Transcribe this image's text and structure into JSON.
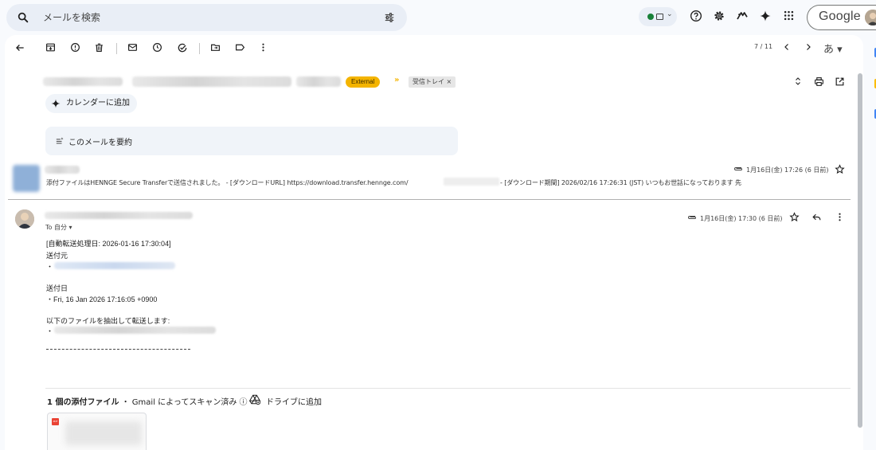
{
  "topbar": {
    "search_placeholder": "メールを検索",
    "google_label": "Google"
  },
  "toolbar": {
    "pager": "7 / 11",
    "ime_label": "あ ▾"
  },
  "thread": {
    "chip_external": "External",
    "chip_inbox": "受信トレイ ×",
    "calendar_button": "カレンダーに追加",
    "summary_button": "このメールを要約"
  },
  "collapsed_message": {
    "snippet_part1": "添付ファイルはHENNGE Secure Transferで送信されました。 - [ダウンロードURL] https://download.transfer.hennge.com/",
    "snippet_part2": " - [ダウンロード期間] 2026/02/16 17:26:31 (JST) いつもお世話になっております 先",
    "date": "1月16日(金) 17:26 (6 日前)"
  },
  "open_message": {
    "date": "1月16日(金) 17:30 (6 日前)",
    "to_line": "To 自分 ▾",
    "body": {
      "line1": "[自動転送処理日: 2026-01-16 17:30:04]",
      "line2": "送付元",
      "line3": "・",
      "line4": "送付日",
      "line5": "・Fri, 16 Jan 2026 17:16:05 +0900",
      "line6": "以下のファイルを抽出して転送します:",
      "line7": "・"
    }
  },
  "attachments": {
    "count_label": "1 個の添付ファイル",
    "scan_label": " ・ Gmail によってスキャン済み ⓘ",
    "drive_label": "ドライブに追加",
    "pdf_badge": "PDF"
  },
  "colors": {
    "external_chip": "#f4b400",
    "status_dot": "#188038",
    "pdf_red": "#ea4335"
  }
}
